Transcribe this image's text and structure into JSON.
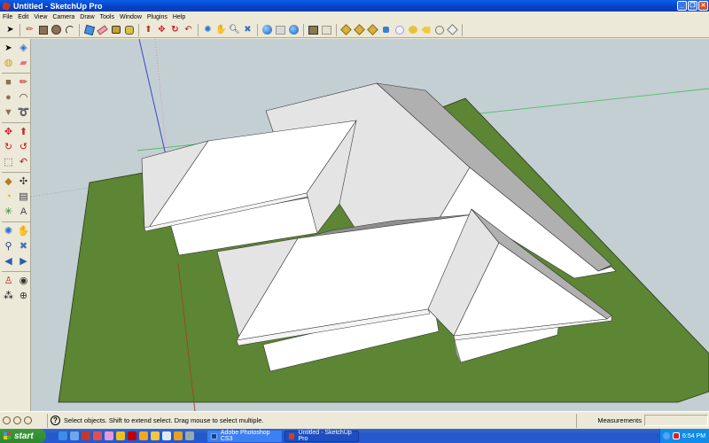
{
  "window": {
    "title": "Untitled - SketchUp Pro",
    "controls": [
      "minimize",
      "restore",
      "close"
    ]
  },
  "menu": [
    "File",
    "Edit",
    "View",
    "Camera",
    "Draw",
    "Tools",
    "Window",
    "Plugins",
    "Help"
  ],
  "top_toolbar": {
    "groups": [
      [
        "select-icon"
      ],
      [
        "pencil-icon",
        "rectangle-icon",
        "circle-icon",
        "arc-icon"
      ],
      [
        "make-component-icon",
        "eraser-icon",
        "tape-measure-icon",
        "paint-bucket-icon"
      ],
      [
        "push-pull-icon",
        "move-icon",
        "rotate-icon",
        "follow-me-icon"
      ],
      [
        "orbit-icon",
        "pan-icon",
        "zoom-icon",
        "zoom-extents-icon"
      ],
      [
        "get-models-icon",
        "share-model-icon",
        "google-earth-icon"
      ],
      [
        "get-current-view-icon",
        "toggle-terrain-icon"
      ],
      [
        "place-model-icon",
        "get-photo-texture-icon",
        "share-component-icon",
        "component-cube-icon",
        "dynamic-component-icon",
        "interact-icon",
        "component-options-icon",
        "outline-icon",
        "section-icon"
      ]
    ]
  },
  "left_toolbar": {
    "tools": [
      "select-icon",
      "make-component-icon",
      "paint-bucket-icon",
      "eraser-icon",
      "rectangle-icon",
      "pencil-icon",
      "circle-icon",
      "arc-icon",
      "polygon-icon",
      "freehand-icon",
      "move-icon",
      "push-pull-icon",
      "rotate-icon",
      "follow-me-icon",
      "scale-icon",
      "offset-icon",
      "tape-measure-icon",
      "dimension-icon",
      "protractor-icon",
      "text-icon",
      "axes-icon",
      "3d-text-icon",
      "orbit-icon",
      "pan-icon",
      "zoom-icon",
      "zoom-extents-icon",
      "previous-view-icon",
      "next-view-icon",
      "position-camera-icon",
      "look-around-icon",
      "walk-icon",
      "section-plane-icon"
    ]
  },
  "viewport": {
    "colors": {
      "sky": "#c4cfd3",
      "ground": "#5c8534",
      "roof_light": "#ffffff",
      "roof_shade": "#e4e4e4",
      "roof_dark": "#b0b0b0",
      "roof_darker": "#8e8e8e",
      "wall": "#ffffff",
      "edge": "#2a2a2a",
      "axis_blue": "#3b46c8",
      "axis_green": "#3fbf5a",
      "axis_red": "#a0451f"
    }
  },
  "statusbar": {
    "icons": [
      "geo-location-icon",
      "credits-icon",
      "user-icon"
    ],
    "help_glyph": "?",
    "message": "Select objects. Shift to extend select. Drag mouse to select multiple.",
    "measurements_label": "Measurements",
    "measurements_value": ""
  },
  "taskbar": {
    "start_label": "start",
    "quick_launch": [
      {
        "name": "ie-icon",
        "color": "#3a8ee6"
      },
      {
        "name": "outlook-icon",
        "color": "#6fa8e8"
      },
      {
        "name": "media-icon",
        "color": "#c0392b"
      },
      {
        "name": "messenger-icon",
        "color": "#e05050"
      },
      {
        "name": "yahoo-icon",
        "color": "#e89ad4"
      },
      {
        "name": "smiley-icon",
        "color": "#f0c020"
      },
      {
        "name": "app-red-icon",
        "color": "#c00000"
      },
      {
        "name": "picasa-icon",
        "color": "#f5a623"
      },
      {
        "name": "box-icon",
        "color": "#f5c542"
      },
      {
        "name": "notepad-icon",
        "color": "#dfe8f3"
      },
      {
        "name": "chrome-icon",
        "color": "#e8a020"
      },
      {
        "name": "network-icon",
        "color": "#9aa"
      }
    ],
    "tasks": [
      {
        "label": "Adobe Photoshop CS3",
        "icon": "photoshop-icon",
        "icon_color": "#1a3f8c",
        "active": false
      },
      {
        "label": "Untitled - SketchUp Pro",
        "icon": "sketchup-icon",
        "icon_color": "#d04020",
        "active": true
      }
    ],
    "clock": "6:54 PM"
  }
}
